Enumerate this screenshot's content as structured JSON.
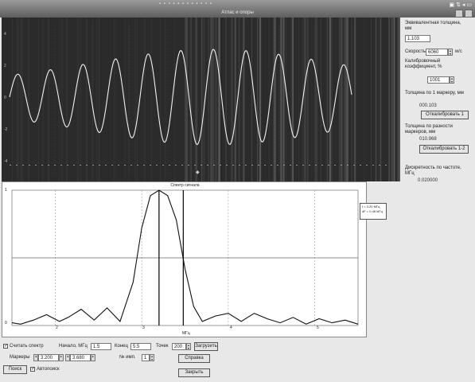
{
  "window": {
    "title": "Атлас и опоры"
  },
  "scope": {
    "y_labels": [
      "4",
      "2",
      "0",
      "-2",
      "-4"
    ]
  },
  "panel": {
    "equiv_thickness_label": "Эквивалентная толщина, мм",
    "equiv_thickness_value": "1.103",
    "speed_label": "Скорость",
    "speed_value": "6060",
    "speed_unit": "м/с",
    "calib_label": "Калибровочный коэффициент, %",
    "calib_value": "1001",
    "thickness_marker1_label": "Толщина по 1 маркеру, мм",
    "thickness_marker1_value": "000.103",
    "calibrate1_button": "Откалибровать 1",
    "thickness_diff_label": "Толщина по разности маркеров, мм",
    "thickness_diff_value": "010.968",
    "calibrate12_button": "Откалибровать 1-2",
    "discreteness_label": "Дискретность по частоте, МГц",
    "discreteness_value": "0.020000"
  },
  "spectrum": {
    "title": "Спектр сигнала",
    "x_ticks": [
      "2",
      "3",
      "4",
      "5"
    ],
    "x_unit": "МГц",
    "y_ticks": [
      "1",
      "0"
    ],
    "legend_line1": "f = 3.20 МГц",
    "legend_line2": "dF = 0.48 МГц"
  },
  "chart_data": {
    "type": "line",
    "title": "Спектр сигнала",
    "xlabel": "МГц",
    "ylabel": "",
    "xlim": [
      1.5,
      5.5
    ],
    "ylim": [
      0,
      1
    ],
    "x": [
      1.5,
      1.6,
      1.75,
      1.9,
      2.05,
      2.15,
      2.3,
      2.45,
      2.6,
      2.75,
      2.9,
      3.0,
      3.1,
      3.2,
      3.3,
      3.4,
      3.5,
      3.6,
      3.7,
      3.85,
      4.0,
      4.15,
      4.3,
      4.45,
      4.6,
      4.75,
      4.9,
      5.05,
      5.2,
      5.35,
      5.5
    ],
    "series": [
      {
        "values": [
          0.02,
          0.01,
          0.04,
          0.08,
          0.03,
          0.06,
          0.12,
          0.04,
          0.13,
          0.03,
          0.32,
          0.72,
          0.96,
          1.0,
          0.96,
          0.78,
          0.42,
          0.14,
          0.03,
          0.07,
          0.09,
          0.03,
          0.09,
          0.05,
          0.02,
          0.06,
          0.01,
          0.05,
          0.02,
          0.04,
          0.01
        ]
      }
    ],
    "markers_x": [
      3.2,
      3.48
    ],
    "grid": true
  },
  "controls": {
    "count_label": "Считать спектр",
    "start_label": "Начало, МГц",
    "start_value": "1.5",
    "end_label": "Конец",
    "end_value": "5.5",
    "points_label": "Точек",
    "points_value": "200",
    "load_button": "Загрузить",
    "markers_label": "Маркеры",
    "marker1_value": "3.200",
    "marker2_value": "3.680",
    "pulse_label": "№ имп.",
    "pulse_value": "1",
    "search_button": "Поиск",
    "autosearch_label": "Автопоиск",
    "help_button": "Справка",
    "close_button": "Закрыть"
  }
}
